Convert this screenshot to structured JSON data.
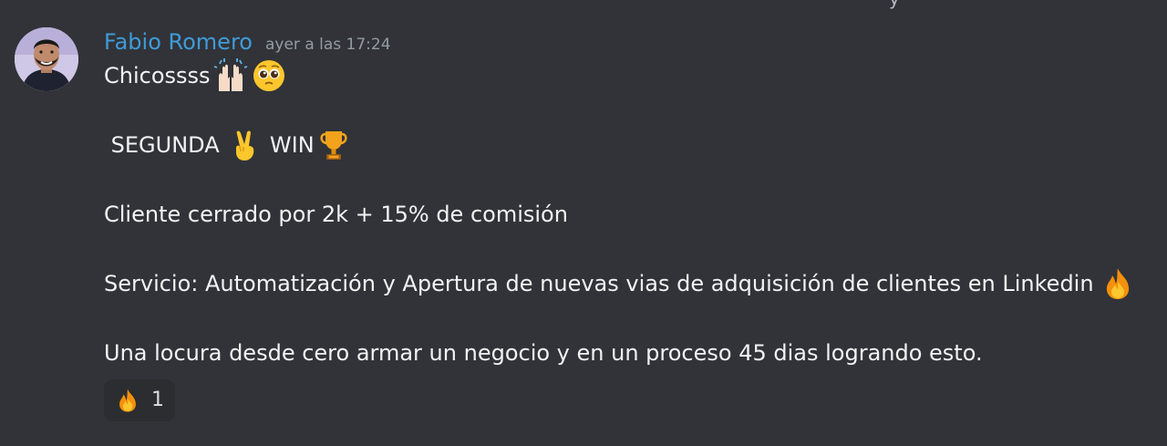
{
  "top_fragment": "y",
  "author": {
    "name": "Fabio Romero",
    "timestamp": "ayer a las 17:24"
  },
  "message": {
    "lines": [
      {
        "parts": [
          {
            "text": "Chicossss"
          },
          {
            "emoji": "raising-hands-icon"
          },
          {
            "emoji": "pleading-face-icon"
          }
        ]
      },
      {
        "blank": true
      },
      {
        "parts": [
          {
            "text": " SEGUNDA "
          },
          {
            "emoji": "victory-hand-icon"
          },
          {
            "text": " WIN"
          },
          {
            "emoji": "trophy-icon"
          }
        ]
      },
      {
        "blank": true
      },
      {
        "parts": [
          {
            "text": "Cliente cerrado por 2k + 15% de comisión"
          }
        ]
      },
      {
        "blank": true
      },
      {
        "parts": [
          {
            "text": "Servicio: Automatización y Apertura de nuevas vias de adquisición de clientes en Linkedin "
          },
          {
            "emoji": "fire-icon"
          }
        ]
      },
      {
        "blank": true
      },
      {
        "parts": [
          {
            "text": "Una locura desde cero armar un negocio y en un proceso 45 dias logrando esto."
          }
        ]
      }
    ]
  },
  "reactions": [
    {
      "emoji": "fire-icon",
      "count": "1"
    }
  ],
  "colors": {
    "background": "#313338",
    "username": "#3f9bd8",
    "timestamp": "#949ba4",
    "text": "#f2f3f5",
    "reaction_bg": "#2b2d31"
  }
}
